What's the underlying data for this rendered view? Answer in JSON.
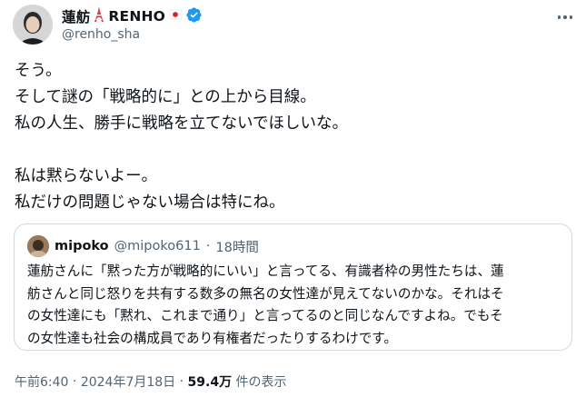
{
  "author": {
    "display_name": "蓮舫",
    "display_name_en": "RENHO",
    "handle": "@renho_sha",
    "avatar_icon": "profile-photo",
    "verified_icon": "verified-badge-icon",
    "accent_color": "#1d9bf0"
  },
  "tweet": {
    "text": "そう。\nそして謎の「戦略的に」との上から目線。\n私の人生、勝手に戦略を立てないでほしいな。\n\n私は黙らないよー。\n私だけの問題じゃない場合は特にね。"
  },
  "quote": {
    "author_name": "mipoko",
    "author_handle": "@mipoko611",
    "separator": "·",
    "time": "18時間",
    "text": "蓮舫さんに「黙った方が戦略的にいい」と言ってる、有識者枠の男性たちは、蓮\n舫さんと同じ怒りを共有する数多の無名の女性達が見えてないのかな。それはそ\nの女性達にも「黙れ、これまで通り」と言ってるのと同じなんですよね。でもそ\nの女性達も社会の構成員であり有権者だったりするわけです。"
  },
  "footer": {
    "time": "午前6:40",
    "separator": " · ",
    "date": "2024年7月18日",
    "views": "59.4万",
    "views_label": " 件の表示"
  }
}
